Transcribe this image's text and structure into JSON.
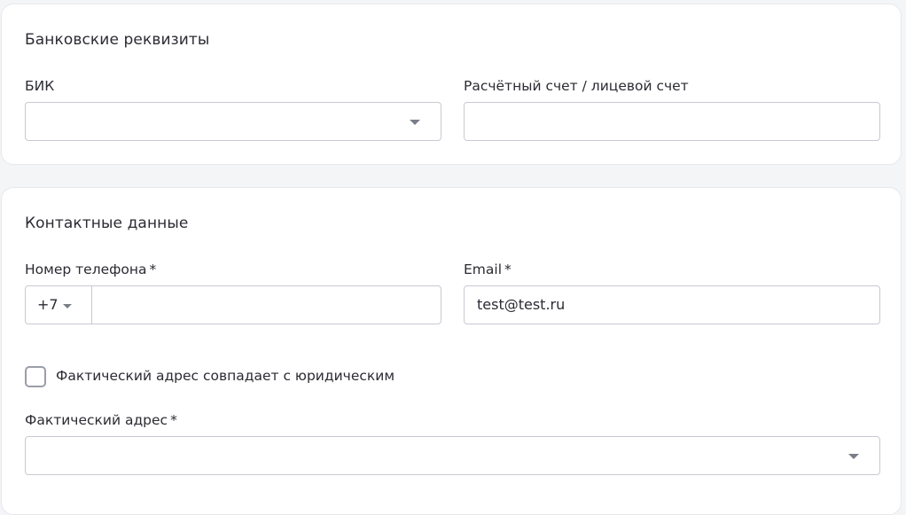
{
  "bank": {
    "title": "Банковские реквизиты",
    "bik": {
      "label": "БИК",
      "value": ""
    },
    "account": {
      "label": "Расчётный счет / лицевой счет",
      "value": ""
    }
  },
  "contacts": {
    "title": "Контактные данные",
    "phone": {
      "label": "Номер телефона",
      "required": "*",
      "code": "+7",
      "value": ""
    },
    "email": {
      "label": "Email",
      "required": "*",
      "value": "test@test.ru"
    },
    "same_address": {
      "label": "Фактический адрес совпадает с юридическим",
      "checked": false
    },
    "actual_address": {
      "label": "Фактический адрес",
      "required": "*",
      "value": ""
    }
  },
  "icons": {
    "dropdown": "chevron-down-icon",
    "checkbox": "checkbox-unchecked-icon"
  },
  "colors": {
    "page_bg": "#f4f5f7",
    "card_bg": "#ffffff",
    "border": "#c7cad1",
    "text": "#2b2b33"
  }
}
